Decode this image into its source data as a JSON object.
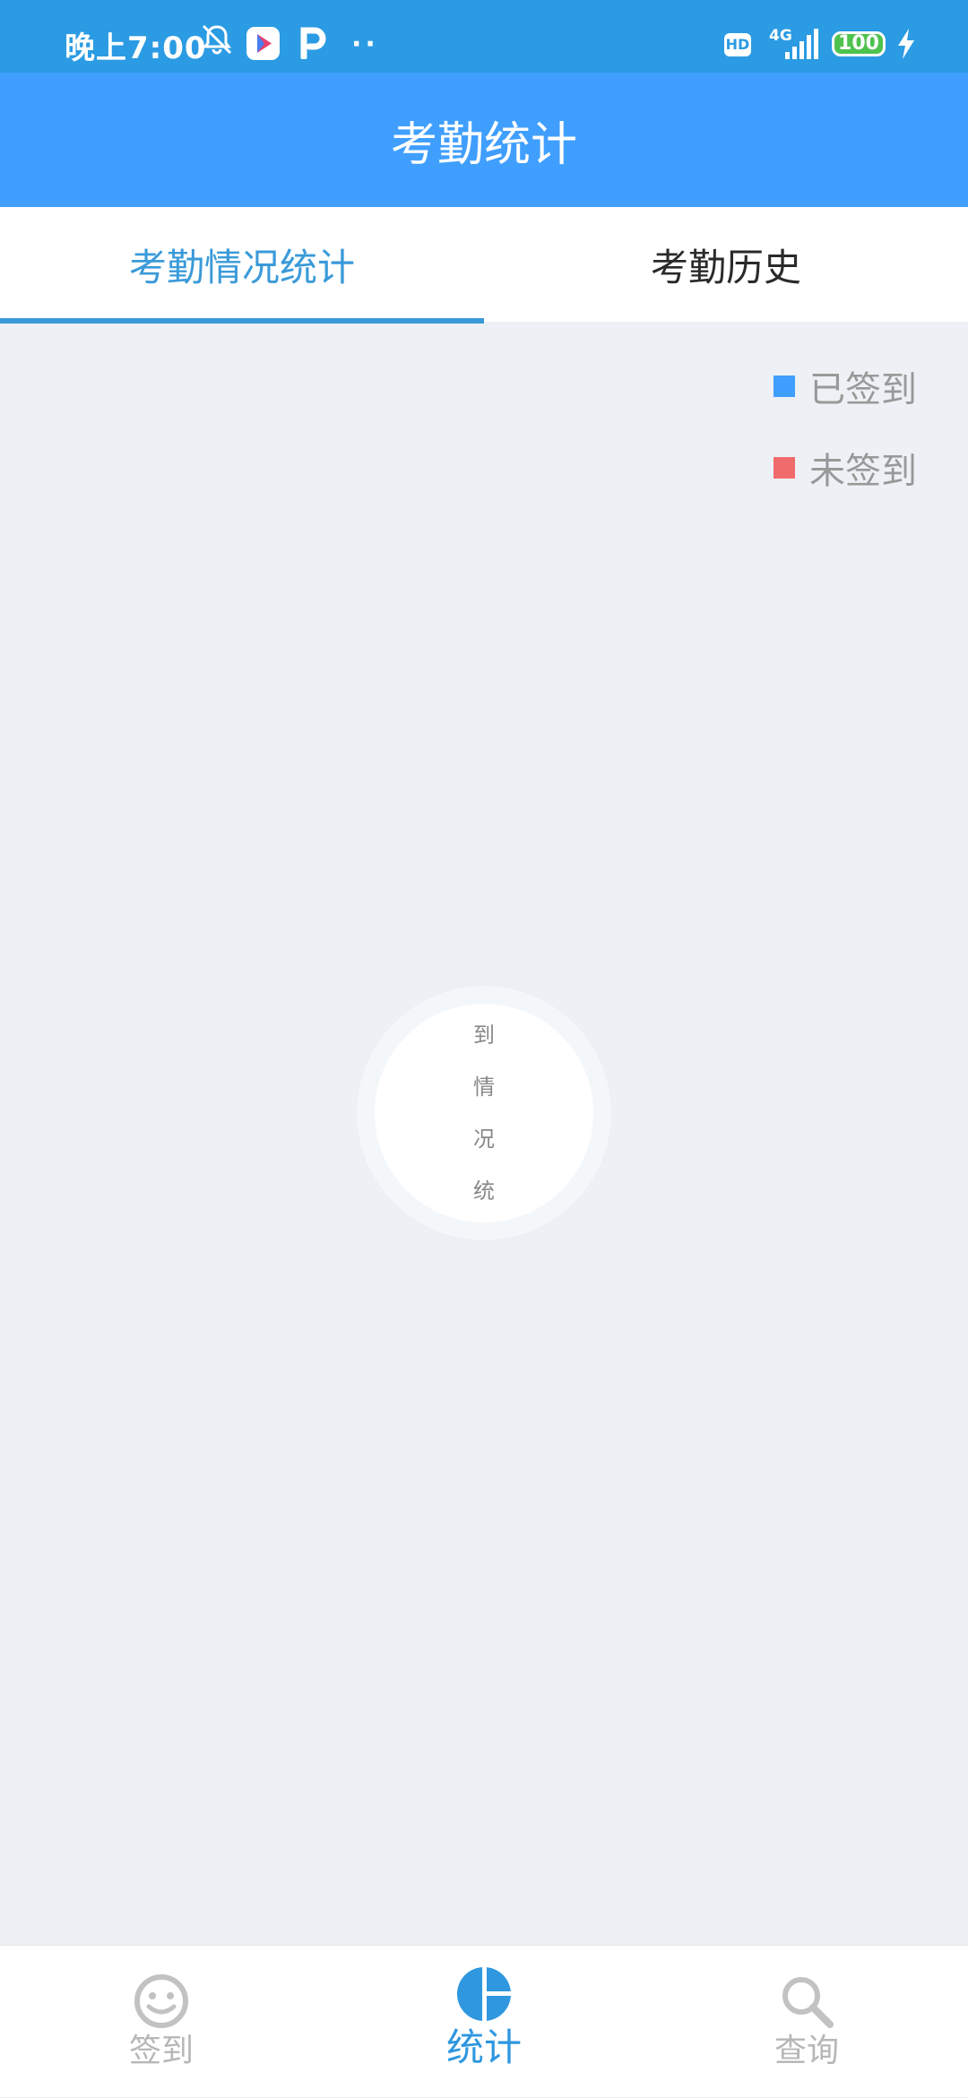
{
  "status_bar": {
    "time": "晚上7:00",
    "hd": "HD",
    "network": "4G",
    "battery": "100",
    "icons": [
      "bell-muted-icon",
      "play-icon",
      "p-app-icon",
      "more-dots-icon",
      "signal-icon",
      "battery-icon",
      "charging-icon"
    ]
  },
  "header": {
    "title": "考勤统计"
  },
  "tabs": [
    {
      "label": "考勤情况统计",
      "active": true
    },
    {
      "label": "考勤历史",
      "active": false
    }
  ],
  "legend": [
    {
      "label": "已签到",
      "color": "#409ffe"
    },
    {
      "label": "未签到",
      "color": "#f06c6c"
    }
  ],
  "chart_placeholder": {
    "chars": [
      "到",
      "情",
      "况",
      "统"
    ]
  },
  "bottom_nav": [
    {
      "label": "签到",
      "icon": "smile-icon",
      "active": false
    },
    {
      "label": "统计",
      "icon": "pie-chart-icon",
      "active": true
    },
    {
      "label": "查询",
      "icon": "search-icon",
      "active": false
    }
  ],
  "colors": {
    "status_bar": "#2b9be3",
    "header": "#409ffe",
    "accent": "#3a9ad9",
    "background": "#edf1f5"
  }
}
